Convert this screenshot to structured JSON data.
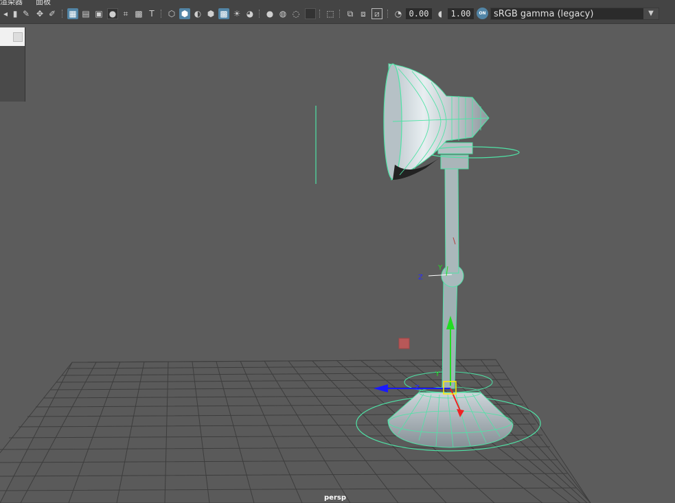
{
  "menubar": {
    "items": [
      "渲染器",
      "面板"
    ]
  },
  "toolbar": {
    "icons": [
      "select-camera-icon",
      "bookmark-icon",
      "edit-icon",
      "pivot-icon",
      "paint-icon",
      "grid-icon",
      "film-gate-icon",
      "resolution-gate-icon",
      "gate-mask-icon",
      "field-chart-icon",
      "safe-action-icon",
      "safe-title-icon",
      "wireframe-icon",
      "smooth-shade-icon",
      "default-material-icon",
      "wireframe-on-shaded-icon",
      "textured-icon",
      "use-lights-icon",
      "shadows-icon",
      "screen-space-ao-icon",
      "motion-blur-icon",
      "anti-aliasing-icon",
      "depth-of-field-icon",
      "isolate-select-icon",
      "xray-icon",
      "xray-joints-icon",
      "backface-culling-icon",
      "exposure-icon",
      "gamma-icon",
      "color-management-icon"
    ],
    "exposure_value": "0.00",
    "gamma_value": "1.00",
    "color_space": "sRGB gamma (legacy)",
    "color_management_badge": "ON"
  },
  "viewport": {
    "camera_label": "persp",
    "manipulator_labels": {
      "y_upper": "Y",
      "z_upper": "Z",
      "y_lower": "Y",
      "z_lower": "Z"
    }
  },
  "colors": {
    "wire_highlight": "#4fe3a6",
    "background": "#5c5c5c",
    "grid": "#3d3d3d",
    "accent": "#5285a6"
  }
}
